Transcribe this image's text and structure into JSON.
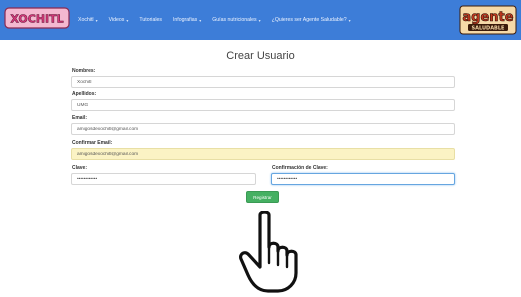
{
  "navbar": {
    "brand_left": "XOCHITL",
    "items": [
      {
        "label": "Xochitl",
        "caret": "▾"
      },
      {
        "label": "Videos",
        "caret": "▾"
      },
      {
        "label": "Tutoriales",
        "caret": ""
      },
      {
        "label": "Infografias",
        "caret": "▾"
      },
      {
        "label": "Guías nutricionales",
        "caret": "▾"
      },
      {
        "label": "¿Quieres ser Agente Saludable?",
        "caret": "▾"
      }
    ],
    "brand_right_line1": "agente",
    "brand_right_line2": "SALUDABLE",
    "bar_color": "#3d7dd8"
  },
  "form": {
    "title": "Crear Usuario",
    "nombres_label": "Nombres:",
    "nombres_value": "Xochitl",
    "apellidos_label": "Apellidos:",
    "apellidos_value": "UMG",
    "email_label": "Email:",
    "email_value": "amigosdexochitl@gmail.com",
    "confirm_email_label": "Confirmar Email:",
    "confirm_email_value": "amigosdexochitl@gmail.com",
    "clave_label": "Clave:",
    "clave_value": "••••••••••••",
    "confirm_clave_label": "Confirmación de Clave:",
    "confirm_clave_value": "••••••••••••",
    "submit_label": "Registrar",
    "submit_color": "#45b062"
  },
  "cursor": {
    "icon": "hand-pointer-icon"
  }
}
